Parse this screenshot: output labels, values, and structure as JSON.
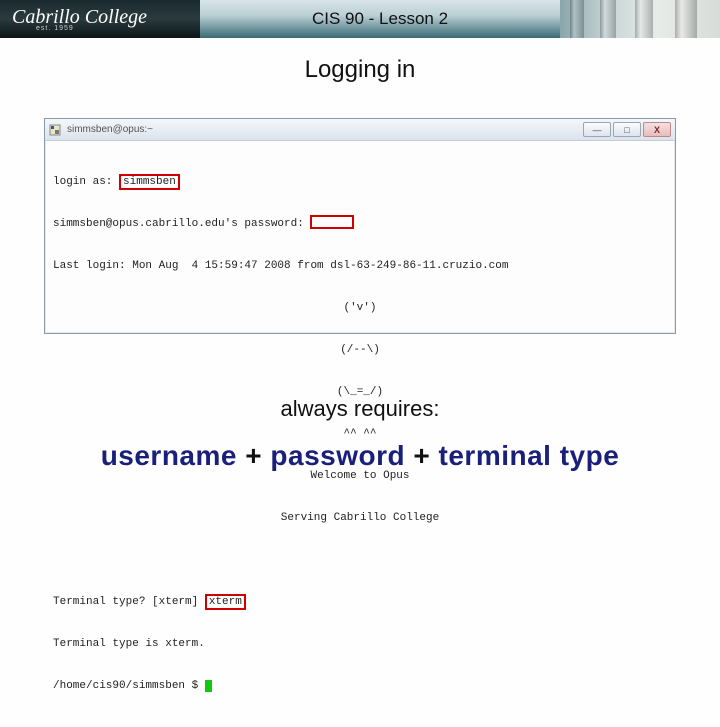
{
  "banner": {
    "logo_text": "Cabrillo College",
    "est_text": "est. 1959",
    "course_title": "CIS 90 - Lesson 2"
  },
  "subtitle": "Logging in",
  "terminal": {
    "window_title": "simmsben@opus:~",
    "buttons": {
      "min": "—",
      "max": "□",
      "close": "X"
    },
    "login_prompt": "login as: ",
    "login_value": "simmsben",
    "pwd_prompt": "simmsben@opus.cabrillo.edu's password: ",
    "last_login": "Last login: Mon Aug  4 15:59:47 2008 from dsl-63-249-86-11.cruzio.com",
    "art1": "('v')",
    "art2": "(/--\\)",
    "art3": "(\\_=_/)",
    "art4": "^^ ^^",
    "welcome1": "Welcome to Opus",
    "welcome2": "Serving Cabrillo College",
    "tt_prompt": "Terminal type? [xterm] ",
    "tt_value": "xterm",
    "tt_confirm": "Terminal type is xterm.",
    "prompt_path": "/home/cis90/simmsben $ "
  },
  "always_text": "always requires:",
  "bigline": {
    "w_username": "username",
    "plus1": " + ",
    "w_password": "password",
    "plus2": " + ",
    "w_ttype": "terminal type"
  }
}
